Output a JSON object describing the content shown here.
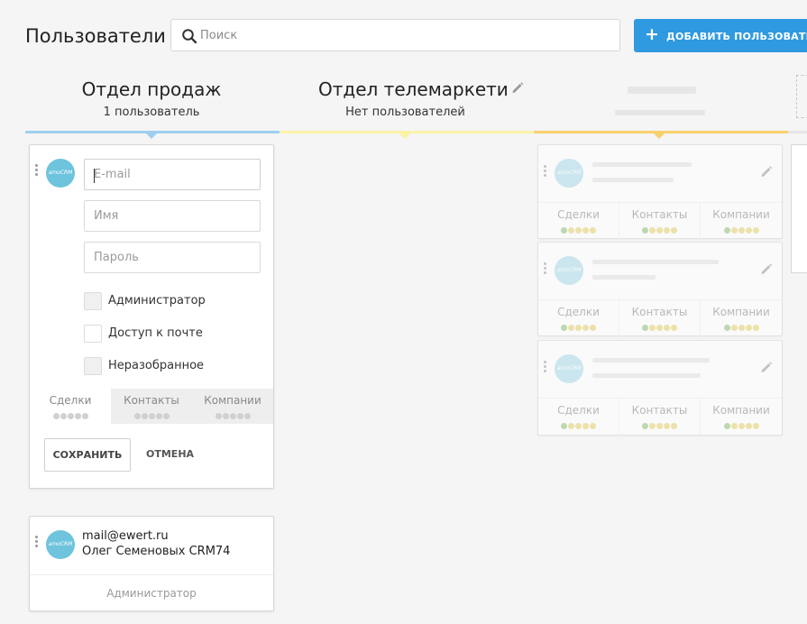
{
  "header": {
    "title": "Пользователи",
    "search_placeholder": "Поиск",
    "add_button_label": "ДОБАВИТЬ ПОЛЬЗОВАТЕЛЯ"
  },
  "columns": [
    {
      "name": "Отдел продаж",
      "count_text": "1 пользователь",
      "color": "#9ecfee"
    },
    {
      "name": "Отдел телемаркетинг",
      "count_text": "Нет пользователей",
      "color": "#fbf2a8"
    },
    {
      "name": "",
      "count_text": "",
      "color": "#f8d06e"
    }
  ],
  "new_user_form": {
    "avatar_text": "amoCRM",
    "email_placeholder": "E-mail",
    "name_placeholder": "Имя",
    "password_placeholder": "Пароль",
    "checkboxes": [
      "Администратор",
      "Доступ к почте",
      "Неразобранное"
    ],
    "tabs": [
      "Сделки",
      "Контакты",
      "Компании"
    ],
    "save_label": "СОХРАНИТЬ",
    "cancel_label": "ОТМЕНА"
  },
  "user_card": {
    "avatar_text": "amoCRM",
    "email": "mail@ewert.ru",
    "name": "Олег Семеновых CRM74",
    "role": "Администратор"
  },
  "ghost_card": {
    "avatar_text": "amoCRM",
    "tabs": [
      "Сделки",
      "Контакты",
      "Компании"
    ]
  }
}
